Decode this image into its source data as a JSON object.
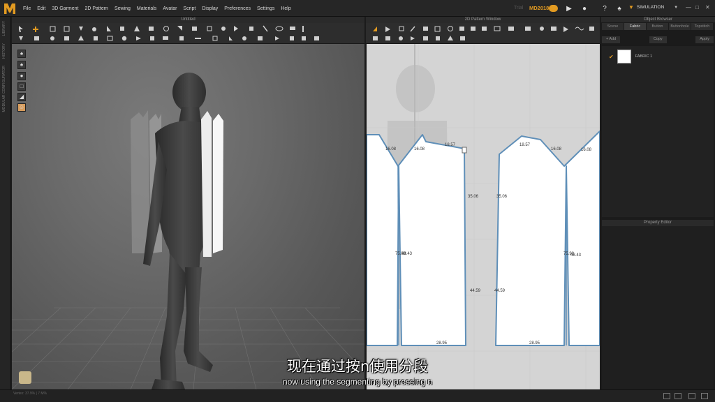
{
  "menu": [
    "File",
    "Edit",
    "3D Garment",
    "2D Pattern",
    "Sewing",
    "Materials",
    "Avatar",
    "Script",
    "Display",
    "Preferences",
    "Settings",
    "Help"
  ],
  "version_label": "Trial",
  "version": "MD2018",
  "mode": "SIMULATION",
  "window3d_title": "Untitled",
  "window2d_title": "2D Pattern Window",
  "left_strip": [
    "LIBRARY",
    "HISTORY",
    "MODULAR CONFIGURATOR"
  ],
  "object_browser": {
    "title": "Object Browser",
    "tabs": [
      "Scene",
      "Fabric",
      "Button",
      "Buttonhole",
      "Topstitch"
    ],
    "active_tab": "Fabric",
    "actions": [
      "+ Add",
      "Copy",
      "Apply"
    ],
    "fabric": "FABRIC 1"
  },
  "property_editor_title": "Property Editor",
  "pattern_measurements": {
    "left_piece": [
      "16.08",
      "16.08",
      "18.57",
      "35.06",
      "75.98",
      "44.59",
      "28.95",
      "48.43"
    ],
    "right_piece": [
      "18.57",
      "16.08",
      "35.06",
      "44.59",
      "75.98",
      "48.43",
      "28.95",
      "16.08"
    ]
  },
  "subtitle_cn": "现在通过按n使用分段",
  "subtitle_en": "now using the segmenting by pressing n",
  "status_coords": "Vertex: 37.9% | 7 M%"
}
